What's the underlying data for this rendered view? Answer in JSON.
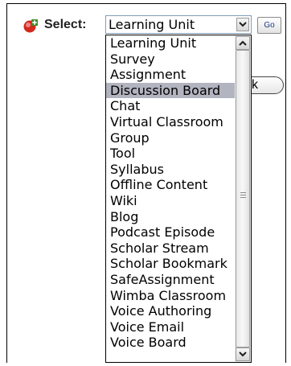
{
  "form": {
    "select_label": "Select:",
    "selected_value": "Learning Unit",
    "go_label": "Go",
    "ok_label_visible": "k"
  },
  "dropdown": {
    "items": [
      "Learning Unit",
      "Survey",
      "Assignment",
      "Discussion Board",
      "Chat",
      "Virtual Classroom",
      "Group",
      "Tool",
      "Syllabus",
      "Offline Content",
      "Wiki",
      "Blog",
      "Podcast Episode",
      "Scholar Stream",
      "Scholar Bookmark",
      "SafeAssignment",
      "Wimba Classroom",
      "Voice Authoring",
      "Voice Email",
      "Voice Board"
    ],
    "highlighted_index": 3
  },
  "icons": {
    "add": "add-icon",
    "dropdown_arrow": "chevron-down-icon",
    "scroll_up": "chevron-up-icon",
    "scroll_down": "chevron-down-icon"
  },
  "colors": {
    "highlight": "#b2b4bf",
    "select_border": "#7f9db9",
    "go_text": "#1a3a8a",
    "icon_red": "#d22a1e"
  }
}
